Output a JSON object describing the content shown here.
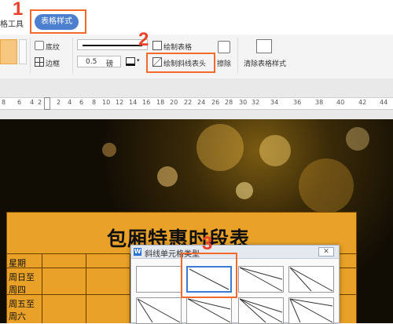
{
  "tabs": {
    "left_partial": "格工具",
    "active": "表格样式"
  },
  "annotations": {
    "step1": "1",
    "step2": "2",
    "step3": "3"
  },
  "ribbon": {
    "shading_label": "底纹",
    "border_label": "边框",
    "line_width_value": "0.5",
    "line_width_unit": "磅",
    "draw_table_label": "绘制表格",
    "draw_diagonal_header_label": "绘制斜线表头",
    "erase_label": "擦除",
    "clear_style_label": "清除表格样式"
  },
  "ruler": {
    "ticks": [
      "8",
      "6",
      "4",
      "2",
      "2",
      "4",
      "6",
      "8",
      "10",
      "12",
      "14",
      "16",
      "18",
      "20",
      "22",
      "24",
      "26",
      "28",
      "30",
      "32",
      "34",
      "36",
      "38",
      "40",
      "42",
      "44"
    ]
  },
  "document": {
    "title": "包厢特惠时段表",
    "rows": [
      "星期",
      "周日至",
      "周四",
      "周五至",
      "周六"
    ]
  },
  "dialog": {
    "title": "斜线单元格类型",
    "close": "✕"
  },
  "colors": {
    "accent_blue": "#4d7fcf",
    "highlight_orange": "#f26a2b",
    "step_red": "#e8432a",
    "table_gold": "#e9a227"
  }
}
